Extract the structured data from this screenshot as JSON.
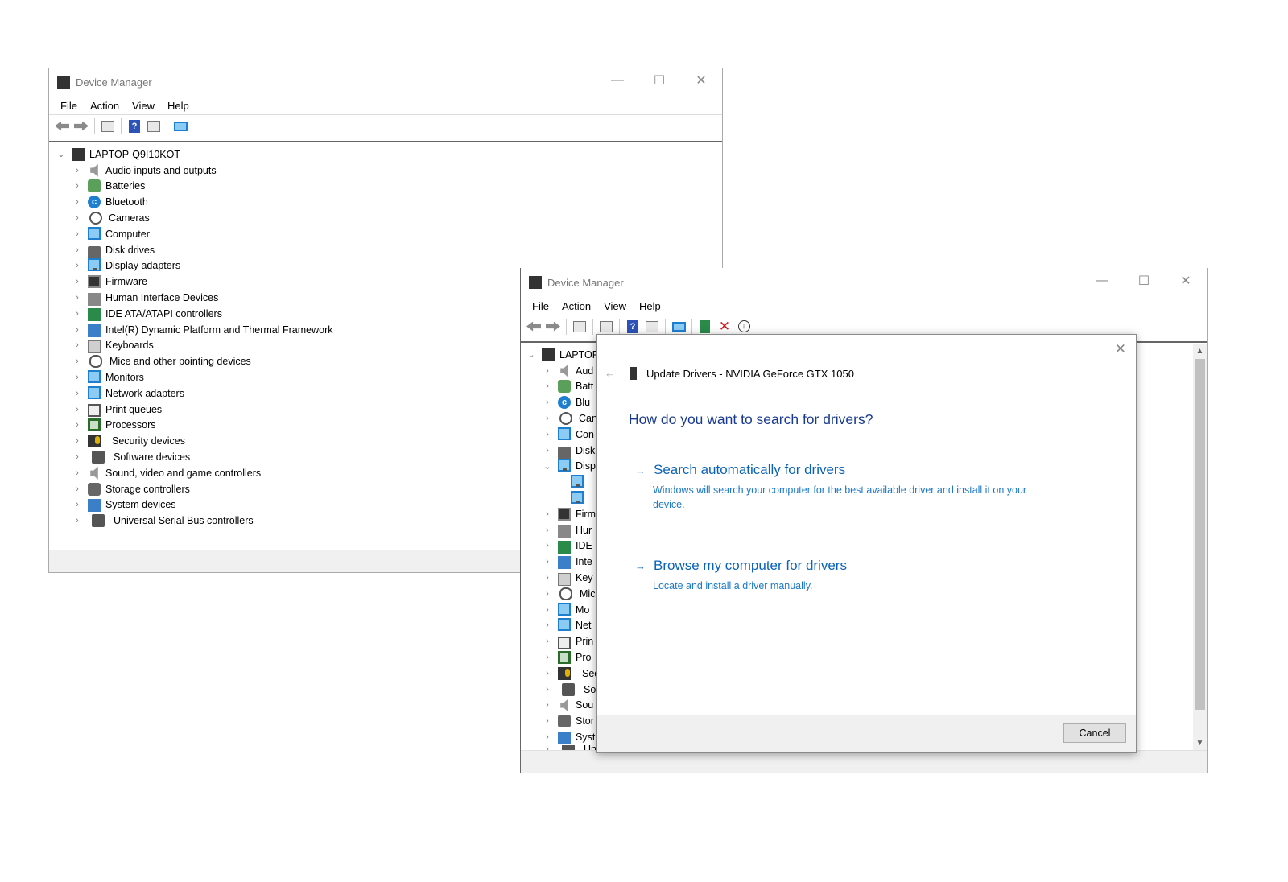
{
  "win1": {
    "title": "Device Manager",
    "menu": [
      "File",
      "Action",
      "View",
      "Help"
    ],
    "root": "LAPTOP-Q9I10KOT",
    "items": [
      "Audio inputs and outputs",
      "Batteries",
      "Bluetooth",
      "Cameras",
      "Computer",
      "Disk drives",
      "Display adapters",
      "Firmware",
      "Human Interface Devices",
      "IDE ATA/ATAPI controllers",
      "Intel(R) Dynamic Platform and Thermal Framework",
      "Keyboards",
      "Mice and other pointing devices",
      "Monitors",
      "Network adapters",
      "Print queues",
      "Processors",
      "Security devices",
      "Software devices",
      "Sound, video and game controllers",
      "Storage controllers",
      "System devices",
      "Universal Serial Bus controllers"
    ]
  },
  "win2": {
    "title": "Device Manager",
    "menu": [
      "File",
      "Action",
      "View",
      "Help"
    ],
    "root": "LAPTOP",
    "items": [
      "Aud",
      "Batt",
      "Blu",
      "Can",
      "Con",
      "Disk",
      "Disp",
      "",
      "",
      "Firm",
      "Hur",
      "IDE",
      "Inte",
      "Key",
      "Mic",
      "Mo",
      "Net",
      "Prin",
      "Pro",
      "Sec",
      "Soft",
      "Sou",
      "Stor",
      "Syst",
      "Uni"
    ]
  },
  "dialog": {
    "header": "Update Drivers - NVIDIA GeForce GTX 1050",
    "question": "How do you want to search for drivers?",
    "option1_title": "Search automatically for drivers",
    "option1_desc": "Windows will search your computer for the best available driver and install it on your device.",
    "option2_title": "Browse my computer for drivers",
    "option2_desc": "Locate and install a driver manually.",
    "cancel_label": "Cancel"
  },
  "icons": {
    "close": "close-icon",
    "back": "back-arrow-icon"
  }
}
